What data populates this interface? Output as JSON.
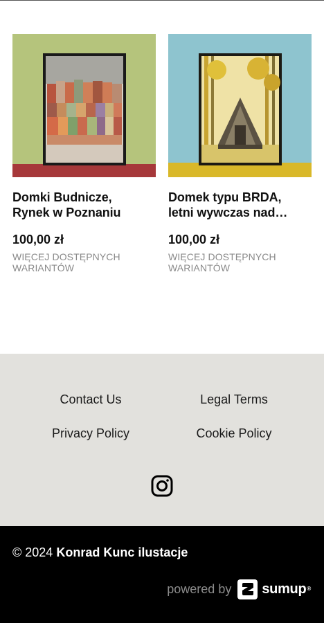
{
  "products": [
    {
      "title_line1": "Domki Budnicze,",
      "title_line2": "Rynek w Poznaniu",
      "price": "100,00 zł",
      "variants_note": "WIĘCEJ DOSTĘPNYCH WARIANTÓW"
    },
    {
      "title_line1": "Domek typu BRDA,",
      "title_line2": "letni wywczas nad…",
      "price": "100,00 zł",
      "variants_note": "WIĘCEJ DOSTĘPNYCH WARIANTÓW"
    }
  ],
  "footer": {
    "links": {
      "contact": "Contact Us",
      "legal": "Legal Terms",
      "privacy": "Privacy Policy",
      "cookie": "Cookie Policy"
    },
    "social_icon": "instagram-icon",
    "copyright_prefix": "© 2024",
    "brand": "Konrad Kunc ilustacje",
    "powered_by": "powered by",
    "sumup_word": "sumup",
    "sumup_reg": "®"
  },
  "colors": {
    "footer_bg": "#e2e1dd",
    "bottom_bar_bg": "#000000",
    "muted_text": "#8a8a8a"
  }
}
